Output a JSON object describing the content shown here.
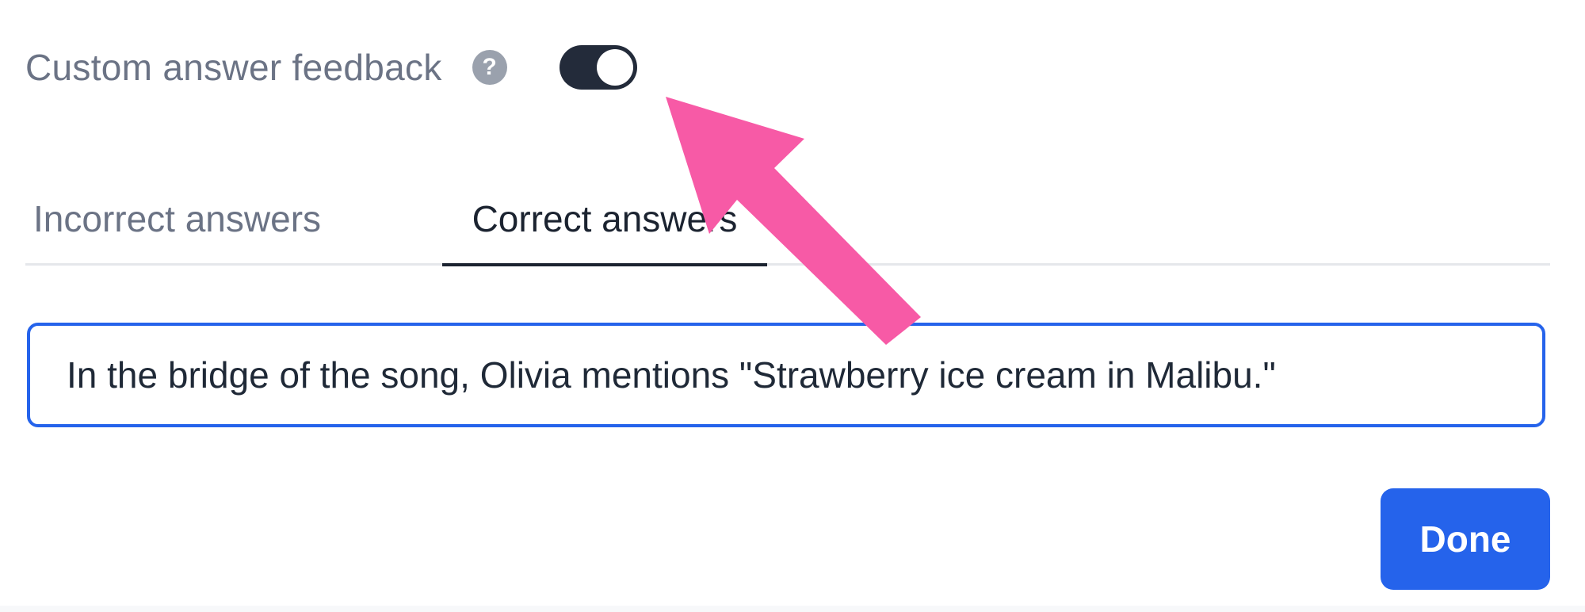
{
  "feedback": {
    "label": "Custom answer feedback",
    "help_icon_text": "?",
    "toggle_on": true
  },
  "tabs": [
    {
      "label": "Incorrect answers",
      "active": false
    },
    {
      "label": "Correct answers",
      "active": true
    }
  ],
  "input": {
    "value": "In the bridge of the song, Olivia mentions \"Strawberry ice cream in Malibu.\""
  },
  "done_button": {
    "label": "Done"
  },
  "annotation": {
    "icon": "arrow-pointer-icon",
    "color": "#f75aa6"
  },
  "colors": {
    "accent": "#2563eb",
    "toggle": "#232b3a",
    "muted_text": "#6b7385",
    "active_tab": "#1b2330"
  }
}
